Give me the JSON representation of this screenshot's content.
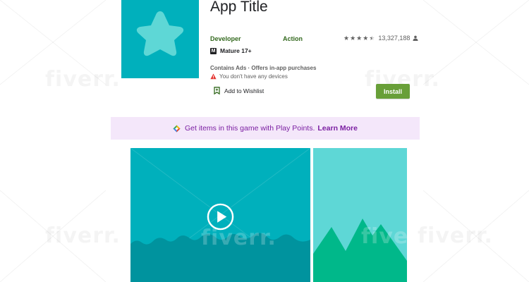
{
  "app": {
    "title": "App Title",
    "developer": "Developer",
    "genre": "Action",
    "rating_stars": 4.5,
    "rating_count": "13,327,188",
    "content_rating": "Mature 17+",
    "content_badge": "M",
    "ads_info": "Contains Ads · Offers in-app purchases",
    "device_warning": "You don't have any devices",
    "wishlist_label": "Add to Wishlist",
    "install_label": "Install"
  },
  "points": {
    "message": "Get items in this game with Play Points.",
    "link_label": "Learn More"
  },
  "watermark": "fiverr.",
  "icons": [
    "star-icon",
    "person-icon",
    "warning-icon",
    "bookmark-icon",
    "play-points-icon",
    "play-icon"
  ],
  "colors": {
    "icon_bg": "#00b0bc",
    "icon_star": "#5ed7d6",
    "install_green": "#689f38",
    "developer_green": "#33691e",
    "points_bg": "#f4e7fa",
    "points_text": "#7b1fa2",
    "shot_bg": "#00b0bc",
    "shot_wave": "#00939e",
    "shot2_bg": "#5ed7d6",
    "mountain": "#00b88a"
  }
}
